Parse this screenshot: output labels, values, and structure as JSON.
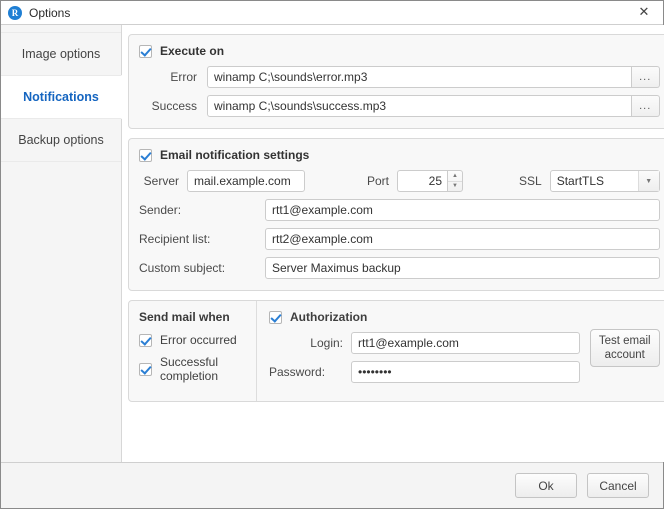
{
  "window": {
    "title": "Options",
    "app_icon": "R",
    "close_icon": "✕"
  },
  "sidebar": {
    "items": [
      {
        "label": "Image options",
        "active": false
      },
      {
        "label": "Notifications",
        "active": true
      },
      {
        "label": "Backup options",
        "active": false
      }
    ]
  },
  "execute_on": {
    "title": "Execute on",
    "checked": true,
    "error_label": "Error",
    "error_value": "winamp C;\\sounds\\error.mp3",
    "success_label": "Success",
    "success_value": "winamp C;\\sounds\\success.mp3",
    "browse_label": "..."
  },
  "email": {
    "title": "Email notification settings",
    "checked": true,
    "server_label": "Server",
    "server_value": "mail.example.com",
    "port_label": "Port",
    "port_value": "25",
    "ssl_label": "SSL",
    "ssl_value": "StartTLS",
    "sender_label": "Sender:",
    "sender_value": "rtt1@example.com",
    "recipient_label": "Recipient list:",
    "recipient_value": "rtt2@example.com",
    "subject_label": "Custom subject:",
    "subject_value": "Server Maximus backup"
  },
  "send_mail_when": {
    "title": "Send mail when",
    "options": [
      {
        "label": "Error occurred",
        "checked": true
      },
      {
        "label": "Successful completion",
        "checked": true
      }
    ]
  },
  "authorization": {
    "title": "Authorization",
    "checked": true,
    "login_label": "Login:",
    "login_value": "rtt1@example.com",
    "password_label": "Password:",
    "password_value": "••••••••",
    "test_button_line1": "Test email",
    "test_button_line2": "account"
  },
  "footer": {
    "ok_label": "Ok",
    "cancel_label": "Cancel"
  },
  "colors": {
    "accent": "#1565c0",
    "check": "#2b7fd4",
    "panel_bg": "#f8f8f8"
  }
}
